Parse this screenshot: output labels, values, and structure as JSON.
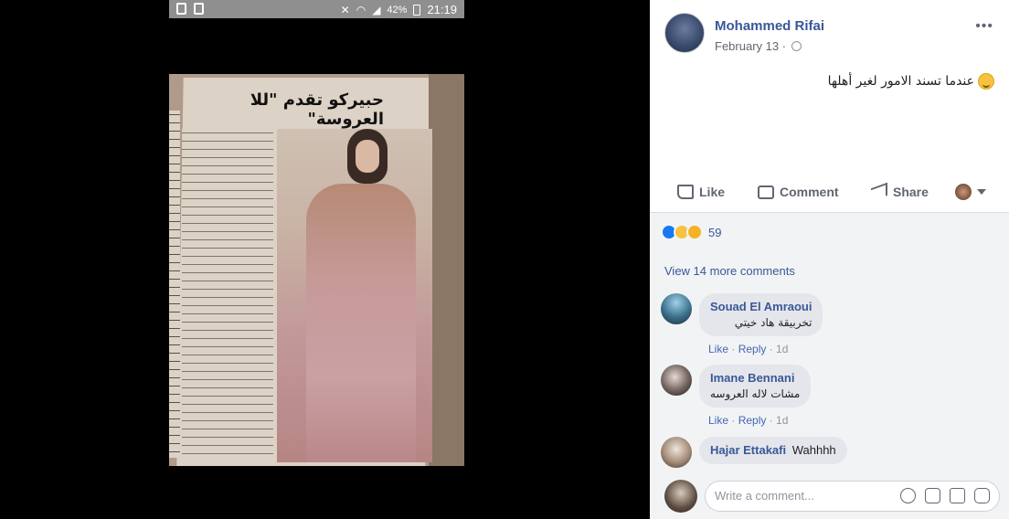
{
  "phone_status": {
    "battery": "42%",
    "time": "21:19"
  },
  "photo": {
    "headline": "حبيركو تقدم \"للا العروسة\""
  },
  "post": {
    "author": "Mohammed Rifai",
    "date": "February 13 ·",
    "more_label": "•••",
    "text": "عندما تسند الامور لغير أهلها"
  },
  "actions": {
    "like": "Like",
    "comment": "Comment",
    "share": "Share"
  },
  "reactions": {
    "count": "59"
  },
  "view_more": "View 14 more comments",
  "comments": [
    {
      "name": "Souad El Amraoui",
      "text": "تخربيقة هاد خيتي",
      "like": "Like",
      "reply": "Reply",
      "time": "1d"
    },
    {
      "name": "Imane Bennani",
      "text": "مشات لاله العروسه",
      "like": "Like",
      "reply": "Reply",
      "time": "1d"
    },
    {
      "name": "Hajar Ettakafi",
      "text": "Wahhhh"
    }
  ],
  "composer": {
    "placeholder": "Write a comment..."
  }
}
